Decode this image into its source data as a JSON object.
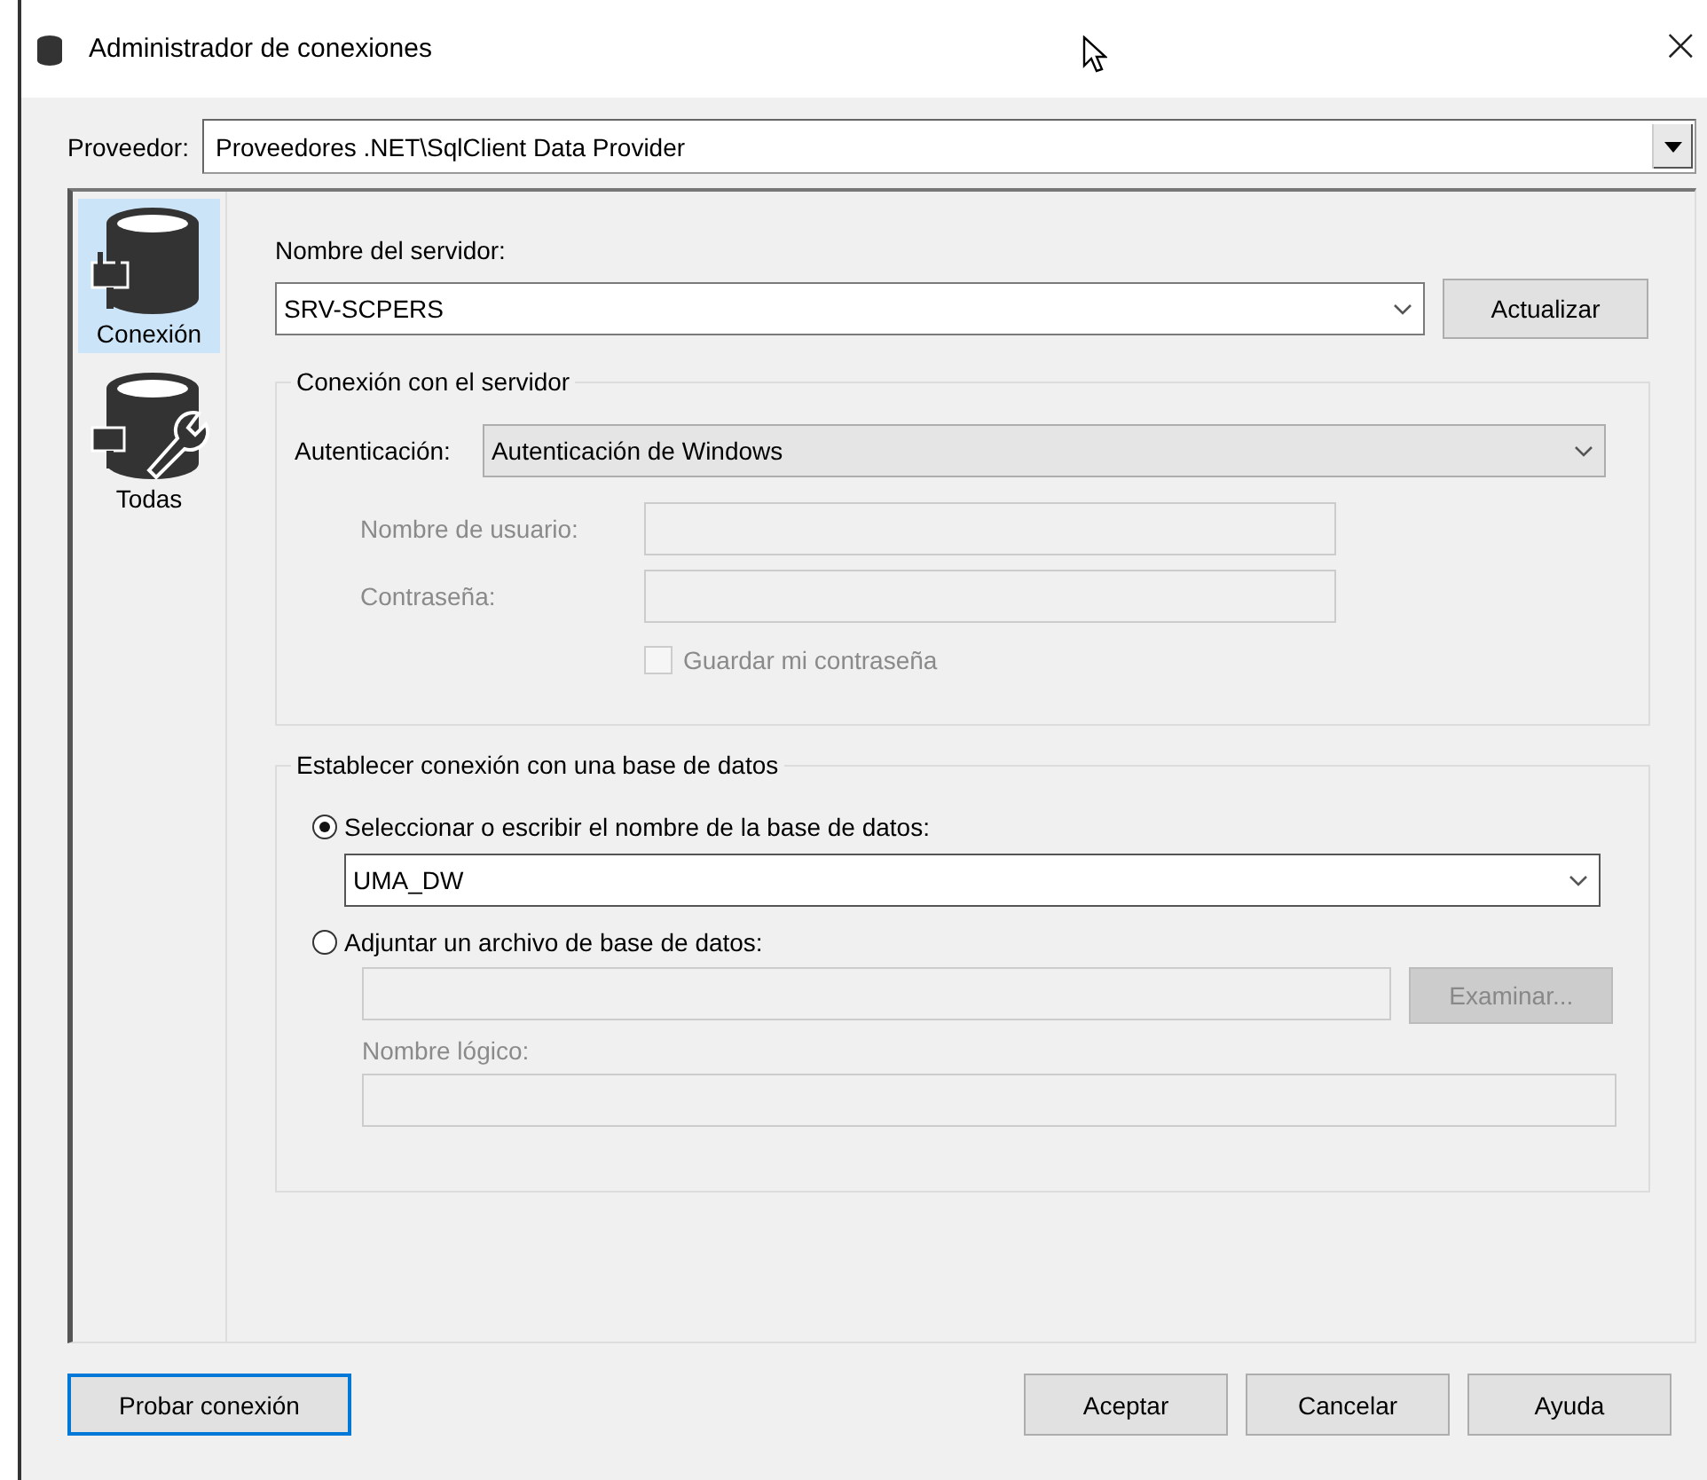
{
  "window": {
    "title": "Administrador de conexiones",
    "close": "×"
  },
  "provider": {
    "label": "Proveedor:",
    "value": "Proveedores .NET\\SqlClient Data Provider"
  },
  "sidebar": {
    "items": [
      {
        "label": "Conexión",
        "kind": "connection",
        "selected": true
      },
      {
        "label": "Todas",
        "kind": "all",
        "selected": false
      }
    ]
  },
  "server": {
    "label": "Nombre del servidor:",
    "value": "SRV-SCPERS",
    "refresh_button": "Actualizar"
  },
  "server_group": {
    "title": "Conexión con el servidor",
    "auth_label": "Autenticación:",
    "auth_value": "Autenticación de Windows",
    "credentials_disabled": true,
    "username_label": "Nombre de usuario:",
    "password_label": "Contraseña:",
    "save_password": {
      "label": "Guardar mi contraseña",
      "checked": false
    }
  },
  "database_group": {
    "title": "Establecer conexión con una base de datos",
    "options": [
      {
        "label": "Seleccionar o escribir el nombre de la base de datos:",
        "selected": true
      },
      {
        "label": "Adjuntar un archivo de base de datos:",
        "selected": false
      }
    ],
    "database": "UMA_DW",
    "browse_button": "Examinar...",
    "logical_name_label": "Nombre lógico:"
  },
  "buttons": [
    {
      "label": "Probar conexión",
      "default": true
    },
    {
      "label": "Aceptar",
      "default": false
    },
    {
      "label": "Cancelar",
      "default": false
    },
    {
      "label": "Ayuda",
      "default": false
    }
  ]
}
